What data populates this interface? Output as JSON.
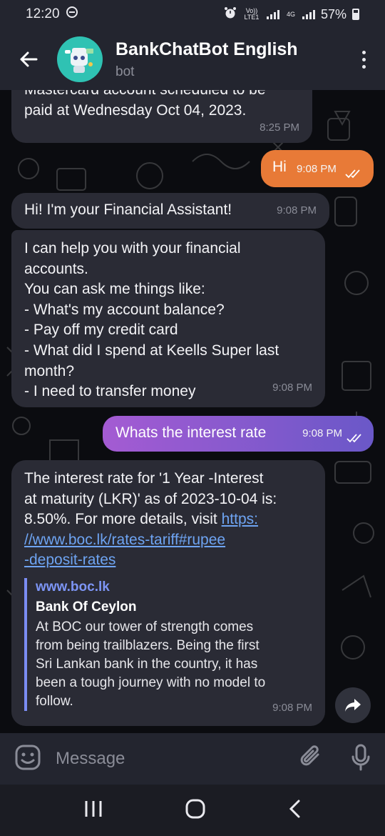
{
  "status_bar": {
    "time": "12:20",
    "volte_label": "Vo)) LTE1",
    "network_label": "4G",
    "battery": "57%"
  },
  "header": {
    "title": "BankChatBot English",
    "subtitle": "bot"
  },
  "messages": [
    {
      "direction": "in",
      "lines": [
        "Mastercard account scheduled to be",
        "paid at Wednesday Oct 04, 2023."
      ],
      "time": "8:25 PM"
    },
    {
      "direction": "out",
      "text": "Hi",
      "time": "9:08 PM",
      "color": "#e87a37"
    },
    {
      "direction": "in",
      "text": "Hi! I'm your Financial Assistant!",
      "time": "9:08 PM"
    },
    {
      "direction": "in",
      "lines": [
        "I can help you with your financial",
        "accounts.",
        "You can ask me things like:",
        "- What's my account balance?",
        "- Pay off my credit card",
        "- What did I spend at Keells Super last",
        "month?",
        "- I need to transfer money"
      ],
      "time": "9:08 PM"
    },
    {
      "direction": "out",
      "text": "Whats the interest rate",
      "time": "9:08 PM",
      "gradient": [
        "#a45bd3",
        "#6a58c8"
      ]
    },
    {
      "direction": "in",
      "lines": [
        "The interest rate for '1 Year -Interest",
        "at maturity (LKR)' as of 2023-10-04 is:",
        "8.50%. For more details, visit"
      ],
      "link_lines": [
        "https:",
        "//www.boc.lk/rates-tariff#rupee",
        "-deposit-rates"
      ],
      "preview": {
        "site": "www.boc.lk",
        "title": "Bank Of Ceylon",
        "description_lines": [
          "At BOC our tower of strength comes",
          "from being trailblazers. Being the first",
          "Sri Lankan bank in the country, it has",
          "been a tough journey with no model to",
          "follow."
        ]
      },
      "time": "9:08 PM"
    }
  ],
  "input": {
    "placeholder": "Message"
  },
  "colors": {
    "header_bg": "#23252f",
    "bubble_in": "#2a2b35",
    "accent_link": "#6ea4f2",
    "bubble_hi": "#e87a37"
  }
}
